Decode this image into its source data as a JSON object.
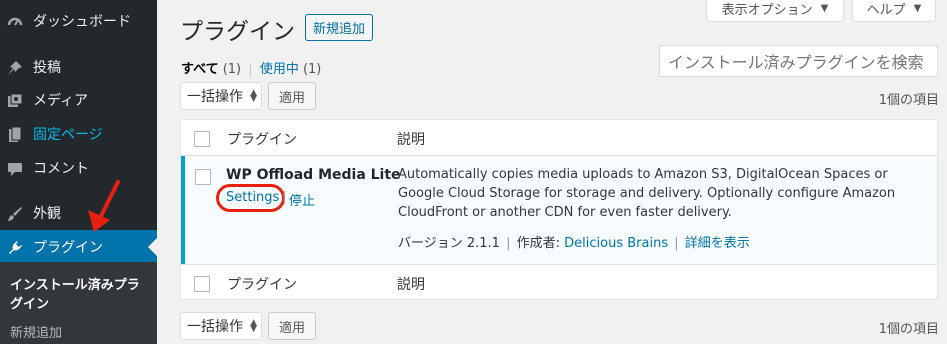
{
  "sidebar": {
    "items": [
      {
        "label": "ダッシュボード",
        "icon": "dashboard-icon"
      },
      {
        "label": "投稿",
        "icon": "pin-icon"
      },
      {
        "label": "メディア",
        "icon": "media-icon"
      },
      {
        "label": "固定ページ",
        "icon": "page-icon"
      },
      {
        "label": "コメント",
        "icon": "comment-icon"
      },
      {
        "label": "外観",
        "icon": "brush-icon"
      },
      {
        "label": "プラグイン",
        "icon": "plugin-icon"
      }
    ],
    "submenu": {
      "installed": "インストール済みプラグイン",
      "add_new": "新規追加"
    }
  },
  "header": {
    "title": "プラグイン",
    "add_new": "新規追加",
    "screen_options": "表示オプション",
    "help": "ヘルプ"
  },
  "views": {
    "all_label": "すべて",
    "all_count": "(1)",
    "separator": "|",
    "active_label": "使用中",
    "active_count": "(1)"
  },
  "search": {
    "placeholder": "インストール済みプラグインを検索"
  },
  "bulk": {
    "selected": "一括操作",
    "apply": "適用",
    "item_count": "1個の項目"
  },
  "table": {
    "col_plugin": "プラグイン",
    "col_description": "説明",
    "rows": [
      {
        "name": "WP Offload Media Lite",
        "settings": "Settings",
        "separator": "|",
        "deactivate": "停止",
        "description": "Automatically copies media uploads to Amazon S3, DigitalOcean Spaces or Google Cloud Storage for storage and delivery. Optionally configure Amazon CloudFront or another CDN for even faster delivery.",
        "version": "バージョン 2.1.1",
        "by": "作成者:",
        "author": "Delicious Brains",
        "details": "詳細を表示"
      }
    ]
  },
  "colors": {
    "sidebar_bg": "#23282d",
    "accent": "#0073aa",
    "annotation": "#e8200f"
  }
}
